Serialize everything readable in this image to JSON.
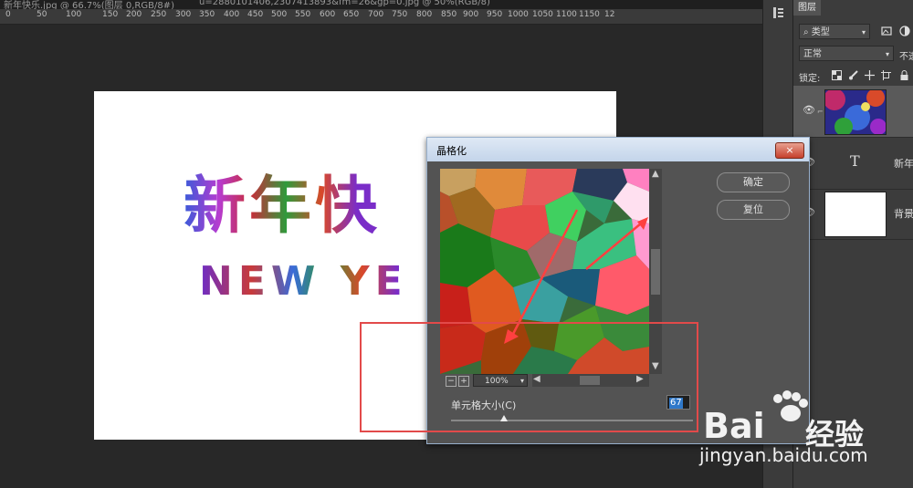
{
  "tabs": [
    {
      "label": "新年快乐.jpg @ 66.7%(图层 0,RGB/8#)"
    },
    {
      "label": "u=2880101406,2307413893&fm=26&gp=0.jpg @ 50%(RGB/8)"
    }
  ],
  "ruler": {
    "ticks": [
      "0",
      "50",
      "100",
      "150",
      "200",
      "250",
      "300",
      "350",
      "400",
      "450",
      "500",
      "550",
      "600",
      "650",
      "700",
      "750",
      "800",
      "850",
      "900",
      "950",
      "1000",
      "1050",
      "1100",
      "1150",
      "12"
    ]
  },
  "canvas": {
    "title": "新年快",
    "subtitle": "NEW YE"
  },
  "layers_panel": {
    "tab_label": "图层",
    "filter_kind": "类型",
    "blend_mode": "正常",
    "opacity_label": "不透",
    "lock_label": "锁定:",
    "layers": [
      {
        "name": "",
        "type": "image",
        "visible": true
      },
      {
        "name": "新年",
        "type": "text",
        "visible": true
      },
      {
        "name": "背景",
        "type": "background",
        "visible": true
      }
    ]
  },
  "dialog": {
    "title": "晶格化",
    "close": "×",
    "ok_label": "确定",
    "reset_label": "复位",
    "zoom": "100%",
    "zoom_minus": "−",
    "zoom_plus": "+",
    "cell_size_label": "单元格大小(C)",
    "cell_size_value": "67",
    "cell_size_fraction": 0.22
  },
  "watermark": {
    "brand": "Bai",
    "brand_cn": "经验",
    "url": "jingyan.baidu.com"
  },
  "colors": {
    "annotation_red": "#e24a4a",
    "dialog_titlebar": "#c3d4ea",
    "highlight": "#2f78c9"
  }
}
